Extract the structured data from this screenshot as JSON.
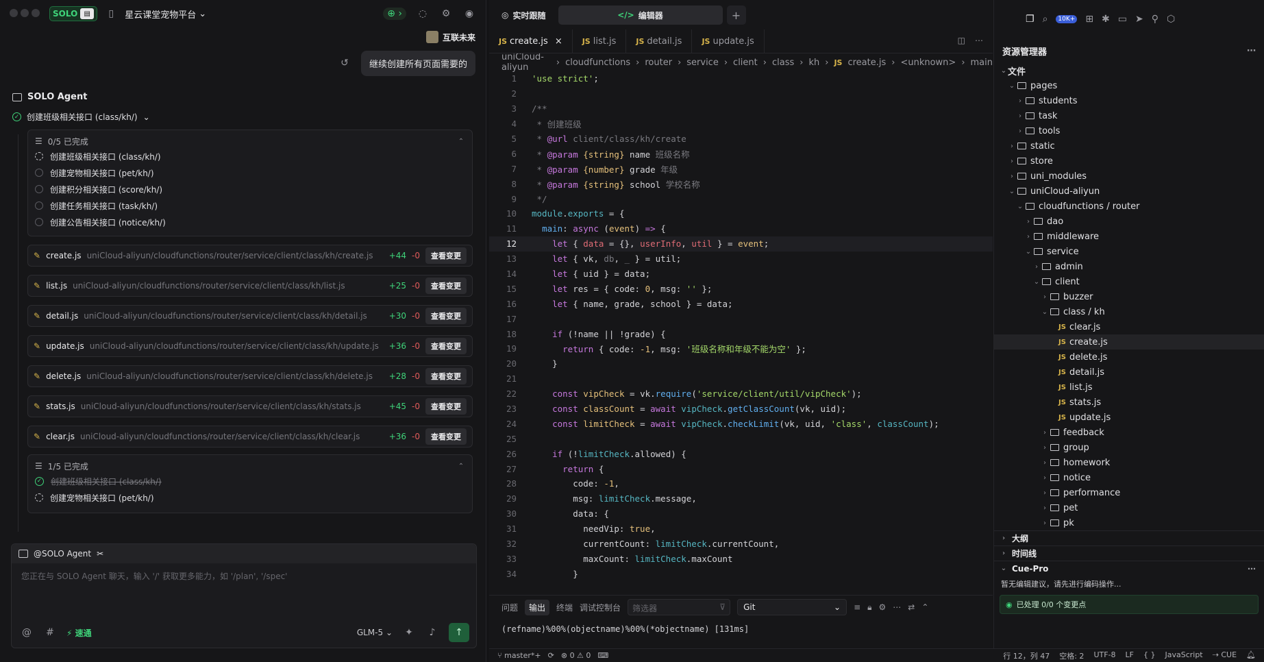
{
  "header": {
    "brand": "SOLO",
    "project": "星云课堂宠物平台",
    "user": "互联未来"
  },
  "chat": {
    "user_message": "继续创建所有页面需要的",
    "agent_name": "SOLO Agent",
    "task_title": "创建班级相关接口 (class/kh/)"
  },
  "todo1": {
    "status": "0/5 已完成",
    "items": [
      "创建班级相关接口 (class/kh/)",
      "创建宠物相关接口 (pet/kh/)",
      "创建积分相关接口 (score/kh/)",
      "创建任务相关接口 (task/kh/)",
      "创建公告相关接口 (notice/kh/)"
    ]
  },
  "files": [
    {
      "name": "create.js",
      "path": "uniCloud-aliyun/cloudfunctions/router/service/client/class/kh/create.js",
      "plus": "+44",
      "minus": "-0",
      "btn": "查看变更"
    },
    {
      "name": "list.js",
      "path": "uniCloud-aliyun/cloudfunctions/router/service/client/class/kh/list.js",
      "plus": "+25",
      "minus": "-0",
      "btn": "查看变更"
    },
    {
      "name": "detail.js",
      "path": "uniCloud-aliyun/cloudfunctions/router/service/client/class/kh/detail.js",
      "plus": "+30",
      "minus": "-0",
      "btn": "查看变更"
    },
    {
      "name": "update.js",
      "path": "uniCloud-aliyun/cloudfunctions/router/service/client/class/kh/update.js",
      "plus": "+36",
      "minus": "-0",
      "btn": "查看变更"
    },
    {
      "name": "delete.js",
      "path": "uniCloud-aliyun/cloudfunctions/router/service/client/class/kh/delete.js",
      "plus": "+28",
      "minus": "-0",
      "btn": "查看变更"
    },
    {
      "name": "stats.js",
      "path": "uniCloud-aliyun/cloudfunctions/router/service/client/class/kh/stats.js",
      "plus": "+45",
      "minus": "-0",
      "btn": "查看变更"
    },
    {
      "name": "clear.js",
      "path": "uniCloud-aliyun/cloudfunctions/router/service/client/class/kh/clear.js",
      "plus": "+36",
      "minus": "-0",
      "btn": "查看变更"
    }
  ],
  "todo2": {
    "status": "1/5 已完成",
    "items": [
      "创建班级相关接口 (class/kh/)",
      "创建宠物相关接口 (pet/kh/)"
    ]
  },
  "input": {
    "mention": "@SOLO Agent",
    "placeholder": "您正在与 SOLO Agent 聊天，输入 '/' 获取更多能力，如 '/plan', '/spec'",
    "fast": "速通",
    "model": "GLM-5"
  },
  "editor": {
    "tab_live": "实时跟随",
    "tab_editor": "编辑器",
    "file_tabs": [
      "create.js",
      "list.js",
      "detail.js",
      "update.js"
    ],
    "breadcrumb": [
      "uniCloud-aliyun",
      "cloudfunctions",
      "router",
      "service",
      "client",
      "class",
      "kh",
      "create.js",
      "<unknown>",
      "main"
    ]
  },
  "bottom": {
    "tabs": [
      "问题",
      "输出",
      "终端",
      "调试控制台"
    ],
    "filter": "筛选器",
    "select": "Git",
    "output": "(refname)%00%(objectname)%00%(*objectname) [131ms]"
  },
  "explorer": {
    "title": "资源管理器",
    "files_label": "文件",
    "outline": "大纲",
    "timeline": "时间线",
    "cue": "Cue-Pro",
    "cue_msg": "暂无编辑建议，请先进行编码操作...",
    "cue_status": "已处理 0/0 个变更点",
    "badge": "10K+"
  },
  "status": {
    "branch": "master*+",
    "errors": "0",
    "warnings": "0",
    "pos": "行 12，列 47",
    "spaces": "空格: 2",
    "enc": "UTF-8",
    "eol": "LF",
    "braces": "{ }",
    "lang": "JavaScript",
    "cue": "CUE"
  }
}
